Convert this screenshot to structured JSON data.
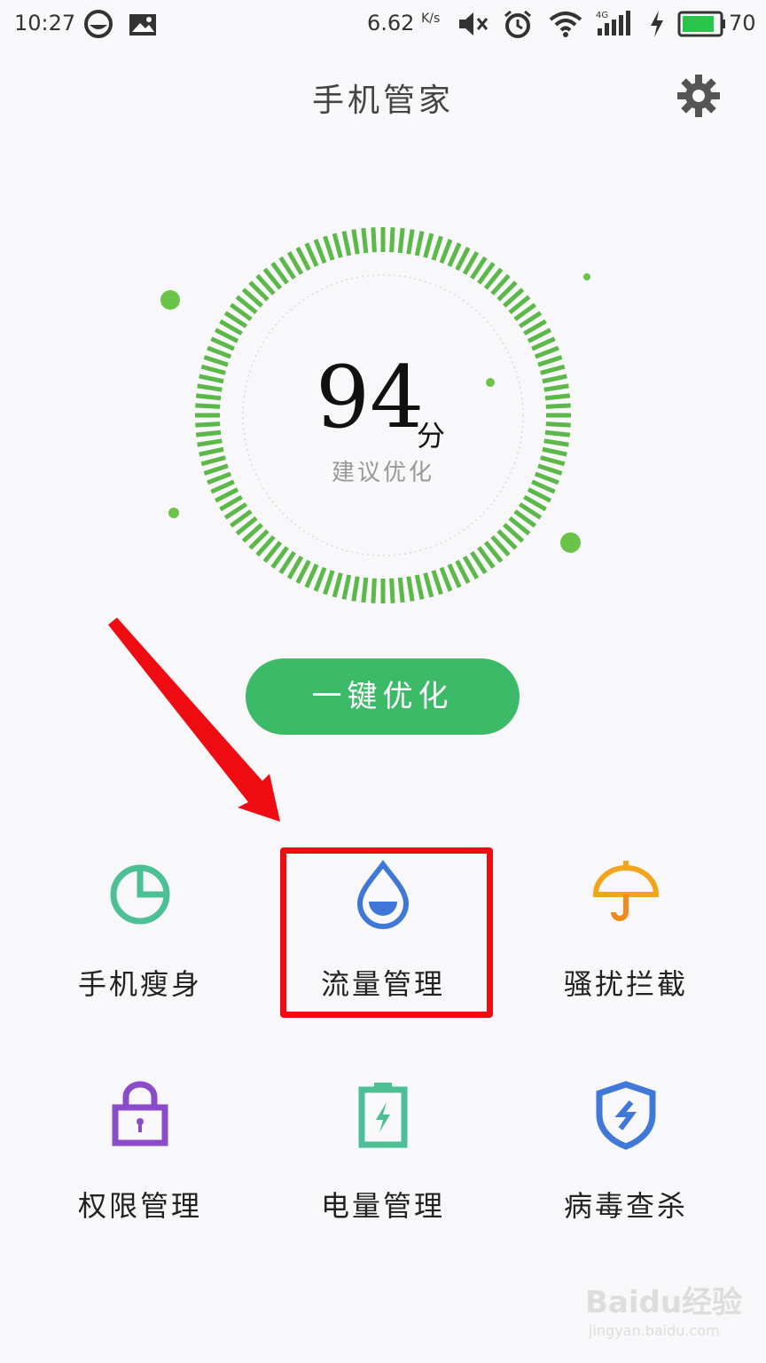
{
  "status_bar": {
    "time": "10:27",
    "net_speed": "6.62",
    "net_speed_unit": "K/s",
    "network_type": "4G",
    "battery_level": "70",
    "icons": [
      "browser-icon",
      "image-icon",
      "mute-icon",
      "alarm-icon",
      "wifi-icon",
      "signal-icon",
      "charging-icon",
      "battery-icon"
    ]
  },
  "header": {
    "title": "手机管家",
    "settings_icon": "gear-icon"
  },
  "score": {
    "value": "94",
    "unit": "分",
    "status": "建议优化",
    "accent_color": "#5cb848"
  },
  "optimize_button": {
    "label": "一键优化",
    "color": "#3dba68"
  },
  "tools": [
    {
      "label": "手机瘦身",
      "icon": "pie-chart-icon",
      "color": "#4dbf95"
    },
    {
      "label": "流量管理",
      "icon": "water-drop-icon",
      "color": "#3f78d8"
    },
    {
      "label": "骚扰拦截",
      "icon": "umbrella-icon",
      "color": "#f2a51c"
    },
    {
      "label": "权限管理",
      "icon": "lock-icon",
      "color": "#8a4cc8"
    },
    {
      "label": "电量管理",
      "icon": "battery-charge-icon",
      "color": "#4dbf95"
    },
    {
      "label": "病毒查杀",
      "icon": "shield-icon",
      "color": "#3f78d8"
    }
  ],
  "annotation": {
    "highlight_color": "#ee0b12"
  },
  "watermark": {
    "brand": "Bai",
    "brand_suffix": "du",
    "site_name": "经验",
    "url": "jingyan.baidu.com"
  }
}
